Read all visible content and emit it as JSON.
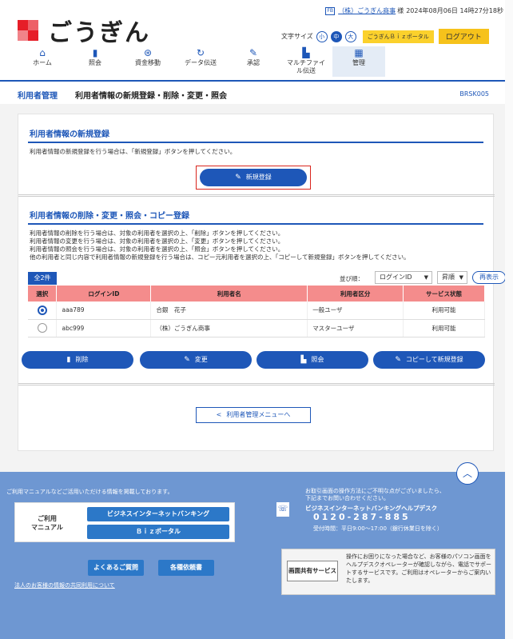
{
  "header": {
    "logo_text": "ごうぎん",
    "user_icon": "FB",
    "user_name": "（株）ごうぎん商事",
    "user_suffix": "様",
    "datetime": "2024年08月06日 14時27分18秒",
    "font_size_label": "文字サイズ",
    "font_sizes": [
      "小",
      "中",
      "大"
    ],
    "portal_link": "ごうぎんＢｉｚポータル",
    "logout": "ログアウト"
  },
  "nav": [
    {
      "label": "ホーム",
      "icon": "home-icon"
    },
    {
      "label": "照会",
      "icon": "document-icon"
    },
    {
      "label": "資金移動",
      "icon": "transfer-icon"
    },
    {
      "label": "データ伝送",
      "icon": "refresh-icon"
    },
    {
      "label": "承認",
      "icon": "approval-icon"
    },
    {
      "label": "マルチファイル伝送",
      "icon": "multifile-icon"
    },
    {
      "label": "管理",
      "icon": "management-icon"
    }
  ],
  "title_bar": {
    "category": "利用者管理",
    "title": "利用者情報の新規登録・削除・変更・照会",
    "code": "BRSK005"
  },
  "section_new": {
    "title": "利用者情報の新規登録",
    "desc": "利用者情報の新規登録を行う場合は、「新規登録」ボタンを押してください。",
    "button": "新規登録"
  },
  "section_manage": {
    "title": "利用者情報の削除・変更・照会・コピー登録",
    "desc": [
      "利用者情報の削除を行う場合は、対象の利用者を選択の上、「削除」ボタンを押してください。",
      "利用者情報の変更を行う場合は、対象の利用者を選択の上、「変更」ボタンを押してください。",
      "利用者情報の照会を行う場合は、対象の利用者を選択の上、「照会」ボタンを押してください。",
      "他の利用者と同じ内容で利用者情報の新規登録を行う場合は、コピー元利用者を選択の上、「コピーして新規登録」ボタンを押してください。"
    ],
    "count": "全2件",
    "sort_label": "並び順：",
    "sort_key": "ログインID",
    "sort_order": "昇順",
    "refresh": "再表示",
    "columns": [
      "選択",
      "ログインID",
      "利用者名",
      "利用者区分",
      "サービス状態"
    ],
    "rows": [
      {
        "login_id": "aaa789",
        "name": "合銀　花子",
        "type": "一般ユーザ",
        "status": "利用可能",
        "selected": true
      },
      {
        "login_id": "abc999",
        "name": "（株）ごうぎん商事",
        "type": "マスターユーザ",
        "status": "利用可能",
        "selected": false
      }
    ],
    "actions": {
      "delete": "削除",
      "edit": "変更",
      "view": "照会",
      "copy": "コピーして新規登録"
    }
  },
  "back_button": "利用者管理メニューへ",
  "footer": {
    "intro": "ご利用マニュアルなどご活用いただける情報を掲載しております。",
    "manual_label_1": "ご利用",
    "manual_label_2": "マニュアル",
    "btn_ib": "ビジネスインターネットバンキング",
    "btn_biz": "Ｂｉｚポータル",
    "btn_faq": "よくあるご質問",
    "btn_forms": "各種依頼書",
    "link": "法人のお客様の情報の共同利用について",
    "help_intro_1": "お取引画面の操作方法にご不明な点がございましたら、",
    "help_intro_2": "下記までお問い合わせください。",
    "help_title": "ビジネスインターネットバンキングヘルプデスク",
    "help_phone": "0120-287-885",
    "help_hours": "受付時間：平日9:00～17:00（銀行休業日を除く）",
    "share_button": "画面共有サービス",
    "share_desc": "操作にお困りになった場合など、お客様のパソコン画面をヘルプデスクオペレーターが確認しながら、電話でサポートするサービスです。ご利用はオペレーターからご案内いたします。"
  }
}
